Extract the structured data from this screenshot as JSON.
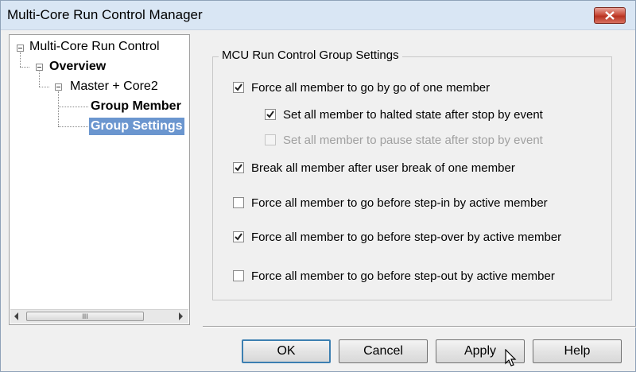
{
  "window": {
    "title": "Multi-Core Run Control Manager"
  },
  "tree": {
    "root": "Multi-Core Run Control",
    "overview": "Overview",
    "group": "Master + Core2",
    "group_member": "Group Member",
    "group_settings": "Group Settings",
    "scrollbar_grip": "III"
  },
  "settings": {
    "legend": "MCU Run Control Group Settings",
    "options": [
      {
        "label": "Force all member to go by go of one member",
        "checked": true,
        "enabled": true
      },
      {
        "label": "Set all member to halted state after stop by event",
        "checked": true,
        "enabled": true
      },
      {
        "label": "Set all member to pause state after stop by event",
        "checked": false,
        "enabled": false
      },
      {
        "label": "Break all member after user break of one member",
        "checked": true,
        "enabled": true
      },
      {
        "label": "Force all member to go before step-in by active member",
        "checked": false,
        "enabled": true
      },
      {
        "label": "Force all member to go before step-over by active member",
        "checked": true,
        "enabled": true
      },
      {
        "label": "Force all member to go before step-out by active member",
        "checked": false,
        "enabled": true
      }
    ]
  },
  "buttons": {
    "ok": "OK",
    "cancel": "Cancel",
    "apply": "Apply",
    "help": "Help"
  },
  "colors": {
    "selection": "#6b96cf",
    "close": "#c94b3a",
    "titlebar": "#d9e6f4"
  }
}
